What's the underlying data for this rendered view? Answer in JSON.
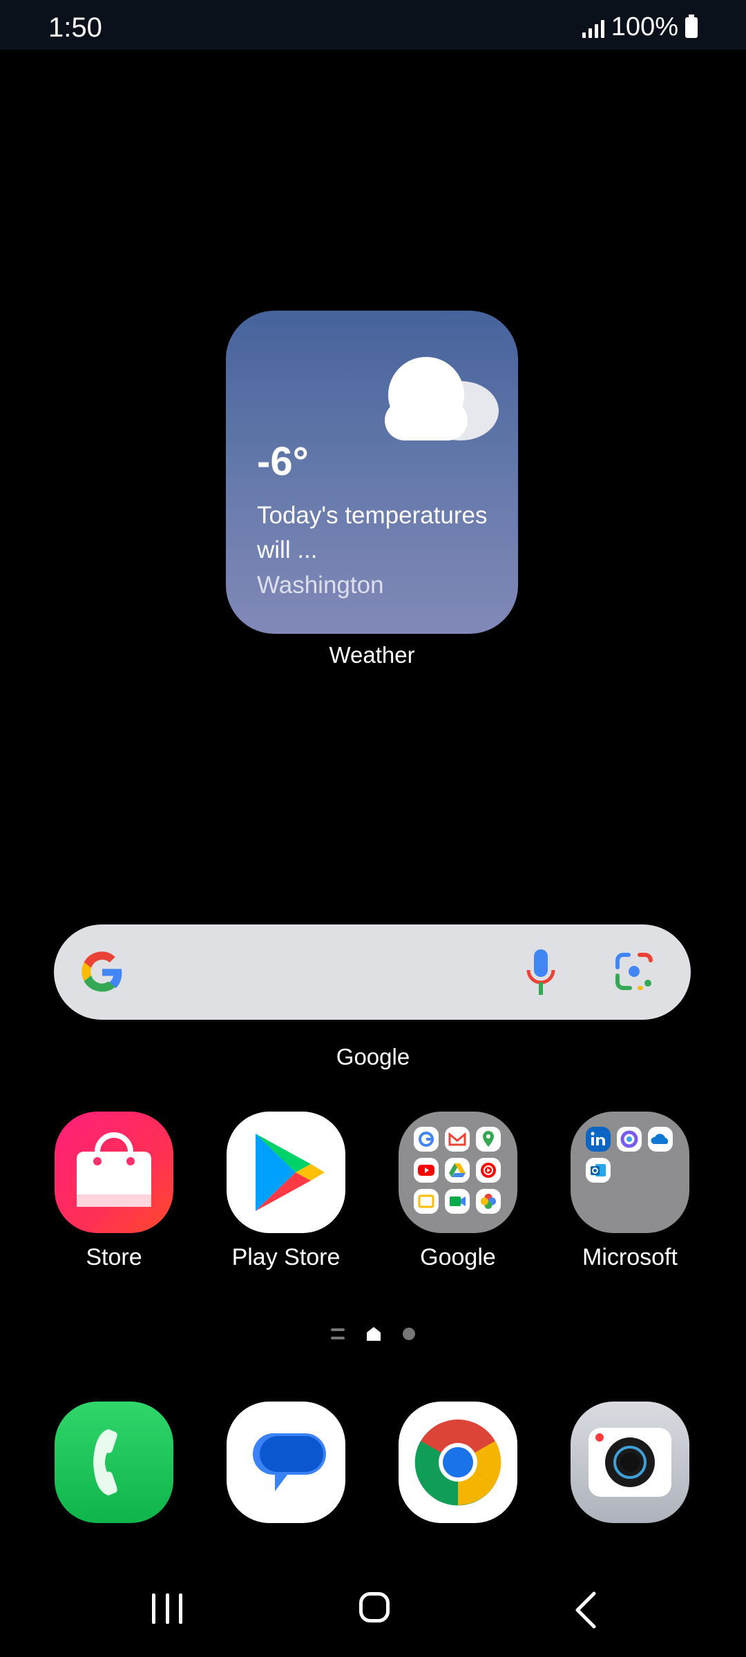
{
  "status_bar": {
    "time": "1:50",
    "battery_percent": "100%",
    "signal_icon": "signal-bars-icon",
    "battery_icon": "battery-icon"
  },
  "weather_widget": {
    "temperature": "-6°",
    "description": "Today's temperatures will ...",
    "location": "Washington",
    "label": "Weather",
    "condition_icon": "cloud-icon",
    "gradient_top": "#46639c",
    "gradient_bottom": "#8289b8"
  },
  "search_widget": {
    "label": "Google",
    "logo_icon": "google-g-icon",
    "mic_icon": "microphone-icon",
    "lens_icon": "google-lens-icon"
  },
  "apps": [
    {
      "label": "Store",
      "icon": "shopping-bag-icon"
    },
    {
      "label": "Play Store",
      "icon": "play-store-icon"
    },
    {
      "label": "Google",
      "icon": "google-folder-icon"
    },
    {
      "label": "Microsoft",
      "icon": "microsoft-folder-icon"
    }
  ],
  "dock": [
    {
      "icon": "phone-icon"
    },
    {
      "icon": "messages-icon"
    },
    {
      "icon": "chrome-icon"
    },
    {
      "icon": "camera-icon"
    }
  ],
  "page_indicator": {
    "pages": 2,
    "current": "home"
  },
  "nav_bar": {
    "recents_icon": "recents-icon",
    "home_icon": "home-icon",
    "back_icon": "back-icon"
  }
}
